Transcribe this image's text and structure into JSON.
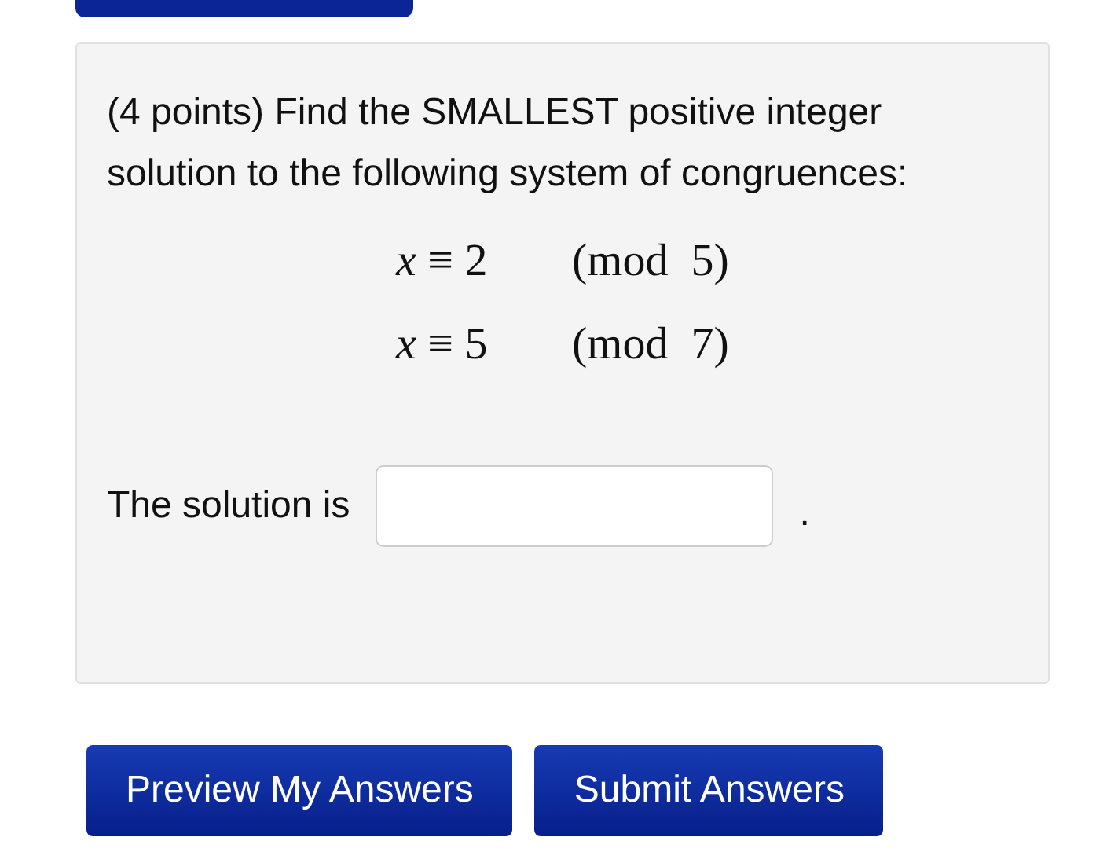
{
  "question": {
    "text": "(4 points) Find the SMALLEST positive integer solution to the following system of congruences:",
    "equations": [
      {
        "congruence": "*x* ≡ 2",
        "modulus": "(mod  5)"
      },
      {
        "congruence": "*x* ≡ 5",
        "modulus": "(mod  7)"
      }
    ],
    "answer": {
      "label": "The solution is",
      "suffix": "."
    }
  },
  "buttons": [
    "Preview My Answers",
    "Submit Answers"
  ]
}
